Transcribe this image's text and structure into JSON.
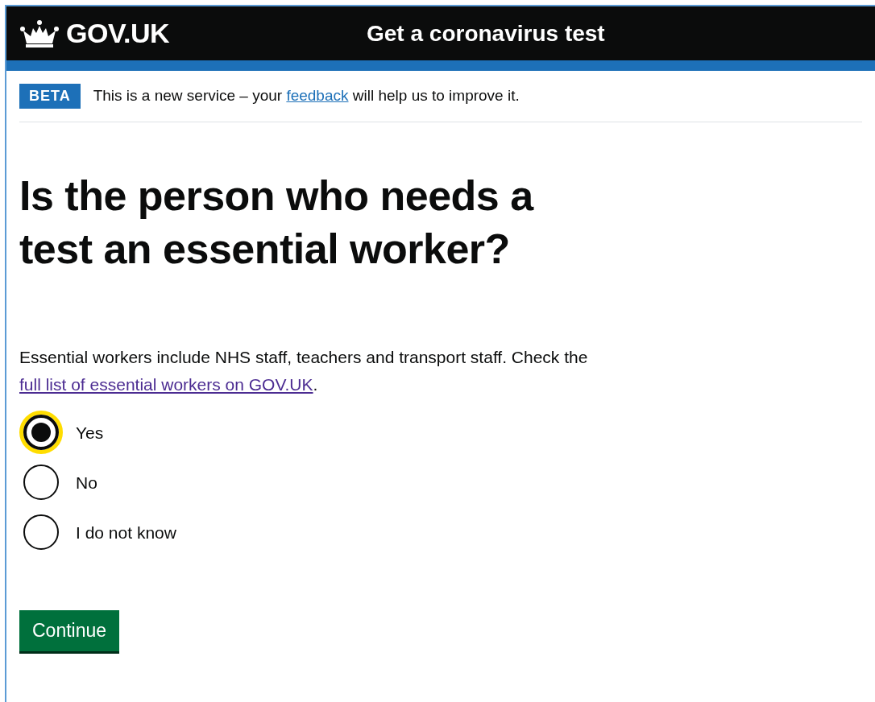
{
  "header": {
    "logo": "GOV.UK",
    "service_name": "Get a coronavirus test"
  },
  "phase_banner": {
    "tag": "BETA",
    "text_before": "This is a new service – your",
    "link": "feedback",
    "text_after": "will help us to improve it."
  },
  "question": {
    "heading": "Is the person who needs a test an essential worker?",
    "hint": {
      "text_before": "Essential workers include NHS staff, teachers and transport staff. Check the",
      "link": "full list of essential workers on GOV.UK",
      "text_after": "."
    },
    "options": [
      {
        "label": "Yes",
        "selected": true,
        "focused": true
      },
      {
        "label": "No",
        "selected": false,
        "focused": false
      },
      {
        "label": "I do not know",
        "selected": false,
        "focused": false
      }
    ]
  },
  "button": "Continue"
}
